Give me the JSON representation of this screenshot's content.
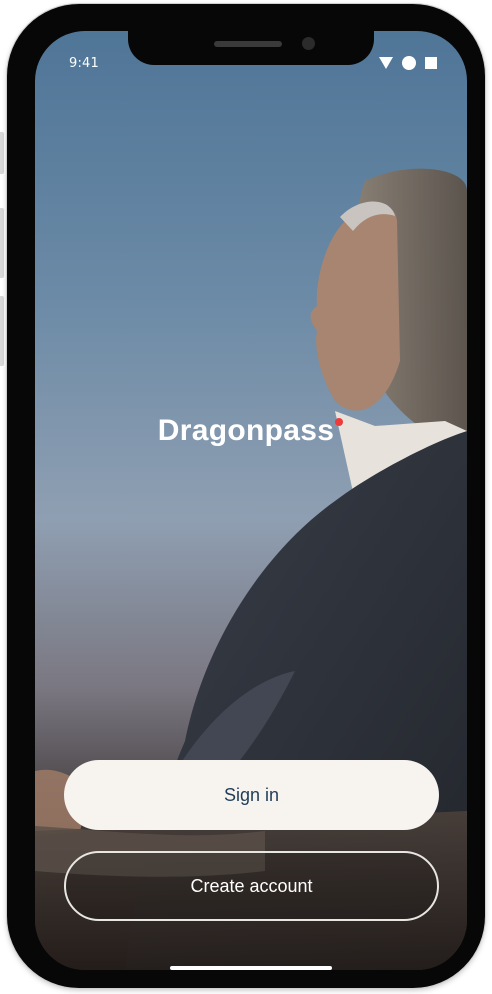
{
  "status_bar": {
    "time": "9:41"
  },
  "brand": {
    "logo_text": "Dragonpass",
    "dot_color": "#ee3b3b"
  },
  "actions": {
    "sign_in_label": "Sign in",
    "create_account_label": "Create account"
  },
  "icons": {
    "wifi": "wifi-icon",
    "signal": "signal-icon",
    "battery": "battery-icon"
  },
  "colors": {
    "sign_in_background": "#f7f4ef",
    "sign_in_text": "#1f3d57"
  }
}
